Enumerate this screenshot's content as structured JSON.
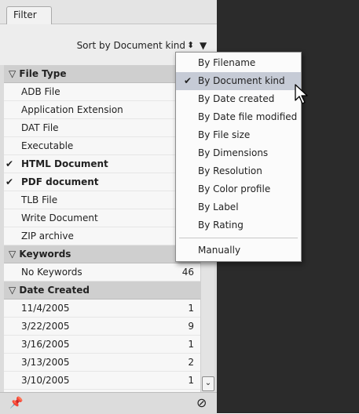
{
  "panel": {
    "tab_label": "Filter",
    "sort_label": "Sort by Document kind",
    "sort_updown_glyph": "⬍",
    "sort_menu_glyph": "▼"
  },
  "sections": [
    {
      "title": "File Type",
      "items": [
        {
          "label": "ADB File",
          "checked": false,
          "count": ""
        },
        {
          "label": "Application Extension",
          "checked": false,
          "count": ""
        },
        {
          "label": "DAT File",
          "checked": false,
          "count": ""
        },
        {
          "label": "Executable",
          "checked": false,
          "count": ""
        },
        {
          "label": "HTML Document",
          "checked": true,
          "count": ""
        },
        {
          "label": "PDF document",
          "checked": true,
          "count": ""
        },
        {
          "label": "TLB File",
          "checked": false,
          "count": ""
        },
        {
          "label": "Write Document",
          "checked": false,
          "count": ""
        },
        {
          "label": "ZIP archive",
          "checked": false,
          "count": ""
        }
      ]
    },
    {
      "title": "Keywords",
      "items": [
        {
          "label": "No Keywords",
          "checked": false,
          "count": "46"
        }
      ]
    },
    {
      "title": "Date Created",
      "items": [
        {
          "label": "11/4/2005",
          "checked": false,
          "count": "1"
        },
        {
          "label": "3/22/2005",
          "checked": false,
          "count": "9"
        },
        {
          "label": "3/16/2005",
          "checked": false,
          "count": "1"
        },
        {
          "label": "3/13/2005",
          "checked": false,
          "count": "2"
        },
        {
          "label": "3/10/2005",
          "checked": false,
          "count": "1"
        }
      ]
    }
  ],
  "menu": {
    "items": [
      {
        "label": "By Filename",
        "selected": false
      },
      {
        "label": "By Document kind",
        "selected": true
      },
      {
        "label": "By Date created",
        "selected": false
      },
      {
        "label": "By Date file modified",
        "selected": false
      },
      {
        "label": "By File size",
        "selected": false
      },
      {
        "label": "By Dimensions",
        "selected": false
      },
      {
        "label": "By Resolution",
        "selected": false
      },
      {
        "label": "By Color profile",
        "selected": false
      },
      {
        "label": "By Label",
        "selected": false
      },
      {
        "label": "By Rating",
        "selected": false
      }
    ],
    "manual_label": "Manually",
    "check_glyph": "✔"
  },
  "glyphs": {
    "section_triangle": "▽",
    "check": "✔",
    "scroll_down": "⌄",
    "pin": "📌",
    "no_entry": "⊘"
  },
  "icons": {
    "section_triangle": "collapse-triangle-icon",
    "pin": "pin-icon",
    "no_entry": "clear-filter-icon",
    "cursor": "mouse-pointer-icon"
  },
  "colors": {
    "panel_bg": "#dcdcdc",
    "header_bg": "#cfcfcf",
    "dark_right": "#2b2b2b",
    "menu_selected": "#c6cbd6"
  }
}
